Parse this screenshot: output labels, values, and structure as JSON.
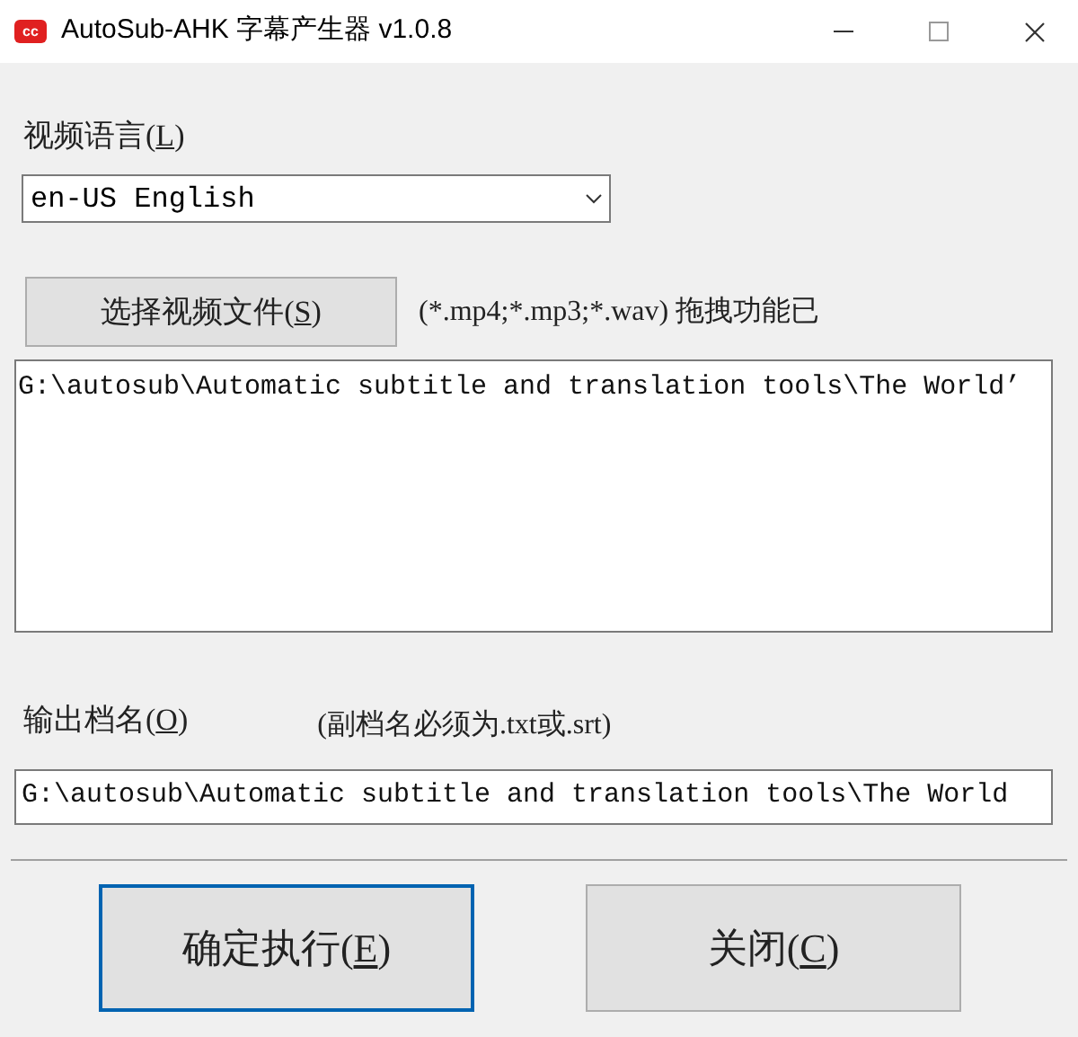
{
  "window": {
    "title": "AutoSub-AHK 字幕产生器 v1.0.8",
    "app_icon_text": "cc"
  },
  "language": {
    "label": {
      "prefix": "视频语言(",
      "mnemonic": "L",
      "suffix": ")"
    },
    "value": "en-US English"
  },
  "choose_button": {
    "prefix": "选择视频文件(",
    "mnemonic": "S",
    "suffix": ")"
  },
  "formats_hint": "(*.mp4;*.mp3;*.wav) 拖拽功能已",
  "file_list": {
    "value": "G:\\autosub\\Automatic subtitle and translation tools\\The World’"
  },
  "output": {
    "label": {
      "prefix": "输出档名(",
      "mnemonic": "O",
      "suffix": ")"
    },
    "hint": "(副档名必须为.txt或.srt)",
    "value": "G:\\autosub\\Automatic subtitle and translation tools\\The World"
  },
  "buttons": [
    {
      "prefix": "确定执行(",
      "mnemonic": "E",
      "suffix": ")",
      "focused": true
    },
    {
      "prefix": "关闭(",
      "mnemonic": "C",
      "suffix": ")",
      "focused": false
    }
  ]
}
